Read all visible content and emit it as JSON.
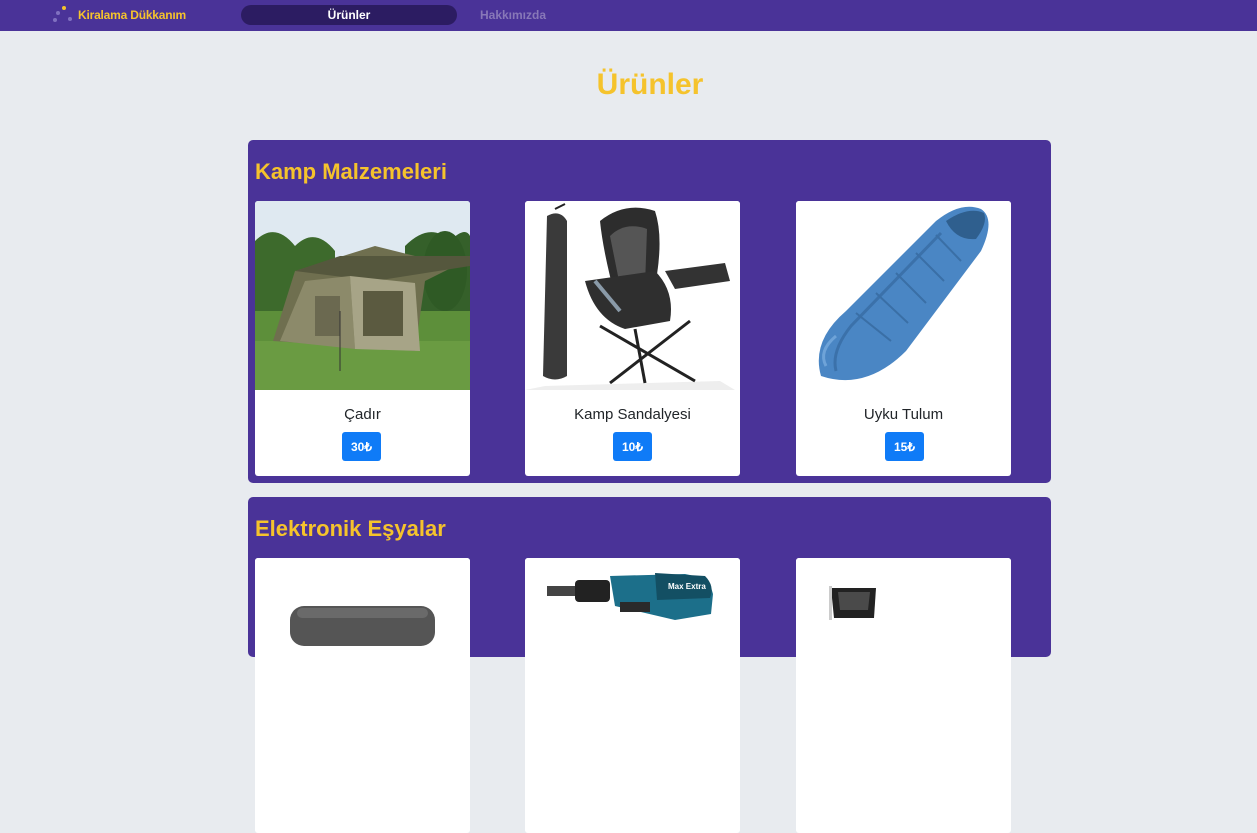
{
  "navbar": {
    "brand": "Kiralama Dükkanım",
    "tabs": [
      {
        "label": "Ürünler",
        "active": true
      },
      {
        "label": "Hakkımızda",
        "active": false
      }
    ]
  },
  "page": {
    "title": "Ürünler"
  },
  "categories": [
    {
      "title": "Kamp Malzemeleri",
      "products": [
        {
          "name": "Çadır",
          "price": "30₺",
          "image": "tent-photo"
        },
        {
          "name": "Kamp Sandalyesi",
          "price": "10₺",
          "image": "camp-chair-photo"
        },
        {
          "name": "Uyku Tulum",
          "price": "15₺",
          "image": "sleeping-bag-photo"
        }
      ]
    },
    {
      "title": "Elektronik Eşyalar",
      "products": [
        {
          "image": "electronic-device-photo"
        },
        {
          "image": "cordless-drill-photo",
          "image_text": "Max Extra"
        },
        {
          "image": "electronic-appliance-photo"
        }
      ]
    }
  ],
  "colors": {
    "navbar": "#4a3398",
    "accent": "#f5c32c",
    "page_bg": "#e8ebef",
    "button": "#0f7bf7",
    "active_tab": "#2c1c62"
  }
}
